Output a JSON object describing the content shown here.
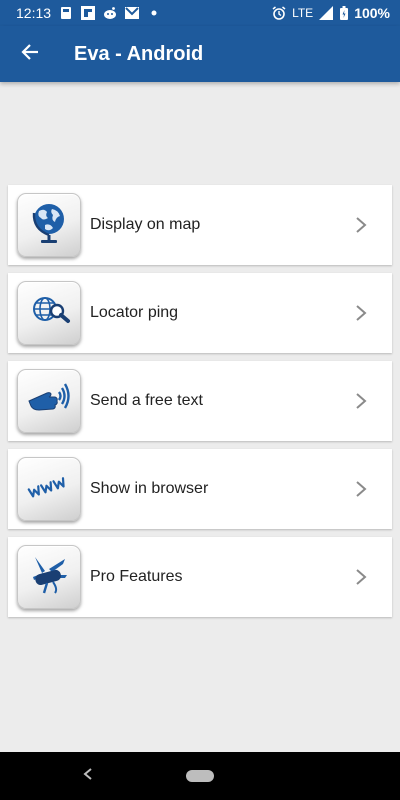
{
  "status_bar": {
    "time": "12:13",
    "network": "LTE",
    "battery": "100%",
    "icons": [
      "notification-icon",
      "flipboard-icon",
      "reddit-icon",
      "gmail-icon",
      "dot-icon",
      "alarm-icon",
      "signal-icon",
      "battery-icon"
    ]
  },
  "app_bar": {
    "title": "Eva - Android",
    "back_icon": "arrow-back-icon"
  },
  "menu": {
    "items": [
      {
        "label": "Display on map",
        "icon": "globe-icon"
      },
      {
        "label": "Locator ping",
        "icon": "globe-search-icon"
      },
      {
        "label": "Send a free text",
        "icon": "pointing-hand-icon"
      },
      {
        "label": "Show in browser",
        "icon": "www-icon"
      },
      {
        "label": "Pro Features",
        "icon": "swiss-knife-icon"
      }
    ],
    "chevron_icon": "chevron-right-icon"
  },
  "colors": {
    "primary": "#1e5a9c",
    "background": "#ececec",
    "icon_blue": "#1f5fa8"
  }
}
